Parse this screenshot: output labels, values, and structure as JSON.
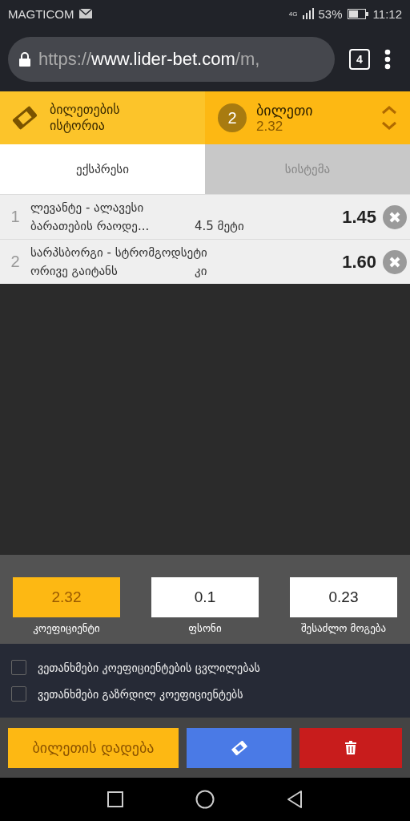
{
  "status_bar": {
    "carrier": "MAGTICOM",
    "network": "4G",
    "battery": "53%",
    "time": "11:12"
  },
  "browser": {
    "url_prefix": "https://",
    "url_host": "www.lider-bet.com",
    "url_rest": "/m,",
    "tab_count": "4"
  },
  "header": {
    "history_label": "ბილეთების ისტორია",
    "ticket_count": "2",
    "ticket_label": "ბილეთი",
    "ticket_odds": "2.32"
  },
  "tabs": [
    {
      "label": "ექსპრესი",
      "selected": true
    },
    {
      "label": "სისტემა",
      "selected": false
    }
  ],
  "bets": [
    {
      "index": "1",
      "match": "ლევანტე - ალავესი",
      "market": "ბარათების რაოდე...",
      "pick": "4.5 მეტი",
      "odds": "1.45"
    },
    {
      "index": "2",
      "match": "სარპსბორგი - სტრომგოდსეტი",
      "market": "ორივე გაიტანს",
      "pick": "კი",
      "odds": "1.60"
    }
  ],
  "summary": [
    {
      "value": "2.32",
      "label": "კოეფიციენტი",
      "highlighted": true
    },
    {
      "value": "0.1",
      "label": "ფსონი",
      "highlighted": false
    },
    {
      "value": "0.23",
      "label": "შესაძლო მოგება",
      "highlighted": false
    }
  ],
  "options": [
    {
      "label": "ვეთანხმები კოეფიციენტების ცვლილებას",
      "checked": false
    },
    {
      "label": "ვეთანხმები გაზრდილ კოეფიციენტებს",
      "checked": false
    }
  ],
  "place_button": "ბილეთის დადება"
}
